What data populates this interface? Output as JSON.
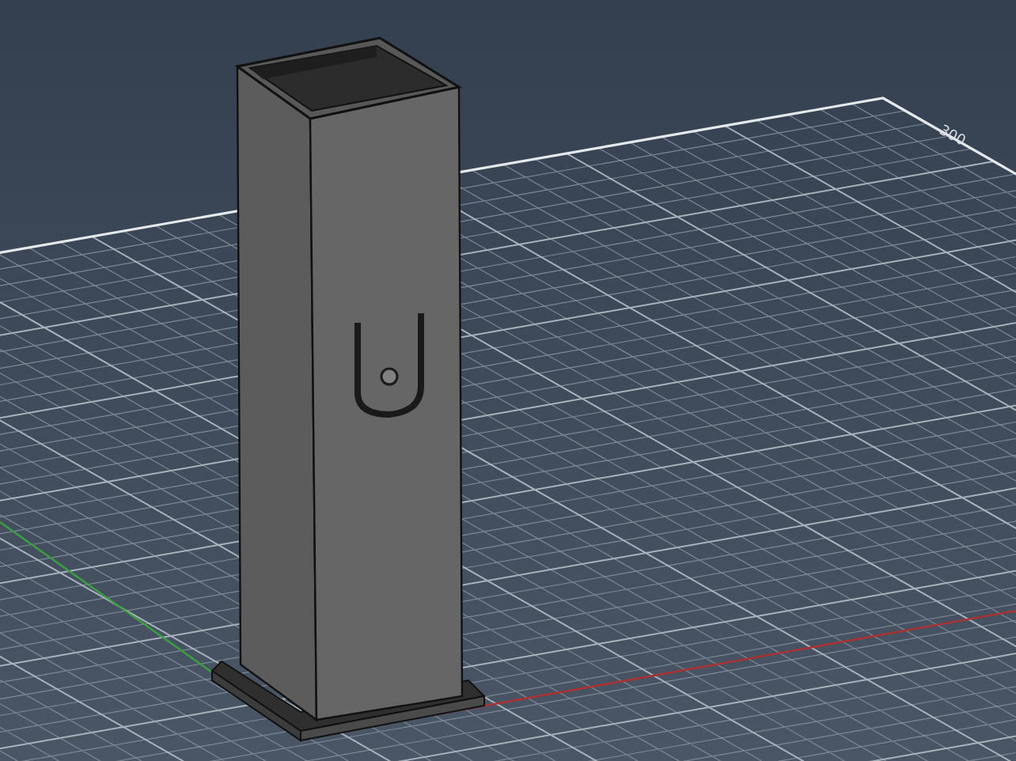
{
  "viewport": {
    "grid_label": "300"
  }
}
